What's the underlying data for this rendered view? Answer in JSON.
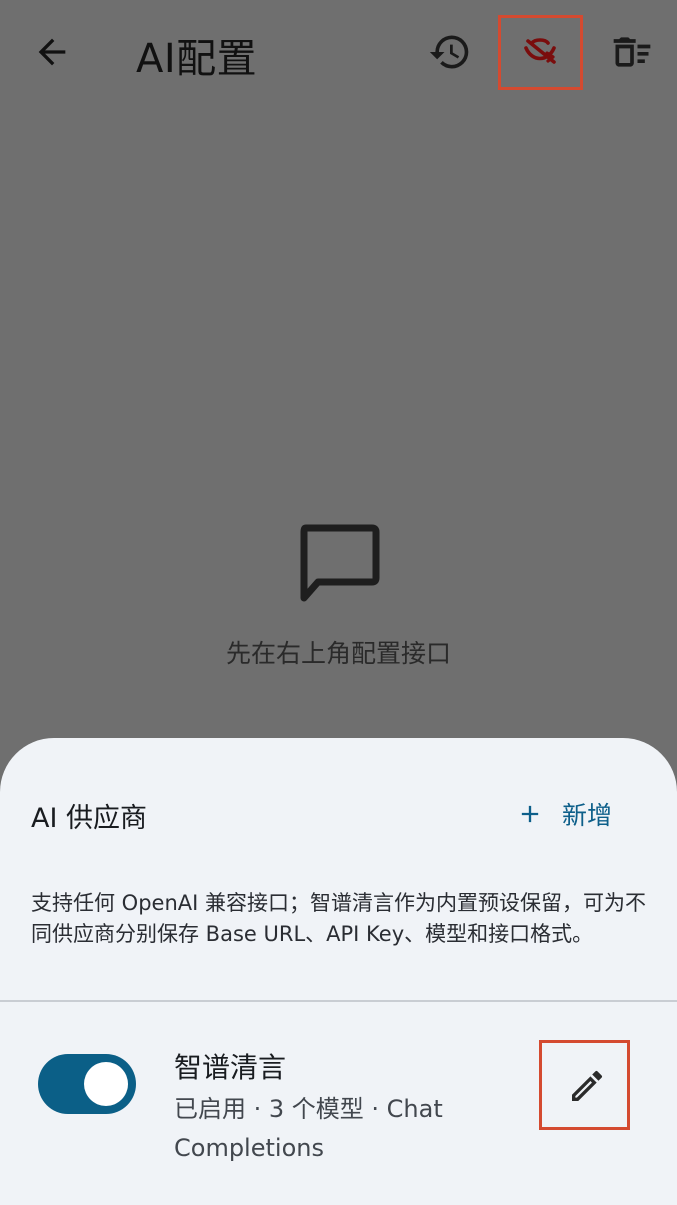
{
  "appbar": {
    "title": "AI配置",
    "icons": [
      "back-arrow-icon",
      "history-icon",
      "visibility-off-icon",
      "clear-list-icon"
    ]
  },
  "empty_state": {
    "icon": "chat-bubble-icon",
    "text": "先在右上角配置接口"
  },
  "sheet": {
    "title": "AI 供应商",
    "add_label": "新增",
    "description": "支持任何 OpenAI 兼容接口；智谱清言作为内置预设保留，可为不同供应商分别保存 Base URL、API Key、模型和接口格式。",
    "providers": [
      {
        "name": "智谱清言",
        "meta": "已启用 · 3 个模型 · Chat Completions",
        "enabled": true
      }
    ]
  },
  "colors": {
    "accent": "#0b5f87",
    "highlight": "#d44a30",
    "scrim": "#6f6f6f",
    "sheet": "#f0f3f7"
  }
}
